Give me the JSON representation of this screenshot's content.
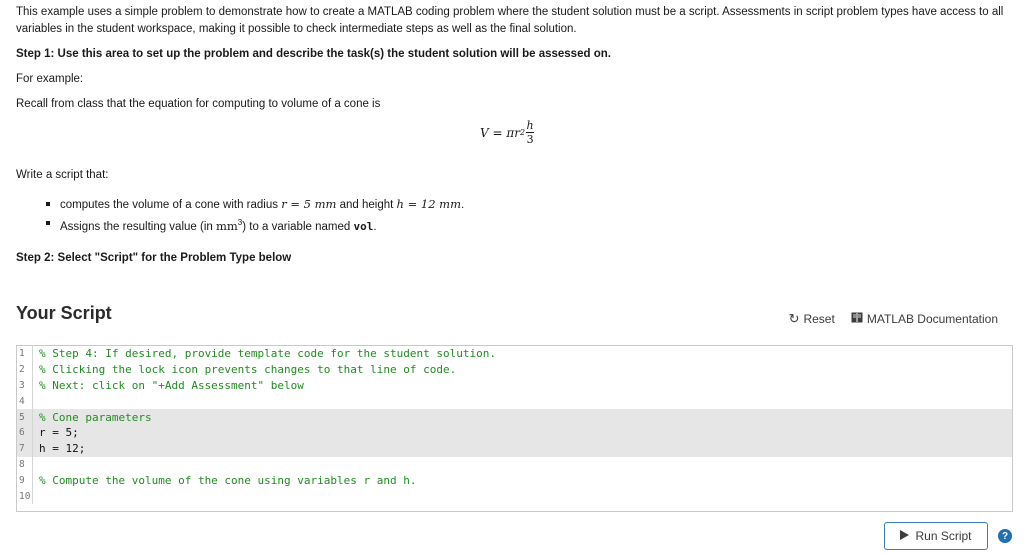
{
  "intro": "This example uses a simple problem to demonstrate how to create a MATLAB coding problem where the student solution must be a script. Assessments in script problem types have access to all variables in the student workspace, making it possible to check intermediate steps as well as the final solution.",
  "step1": "Step 1: Use this area to set up the problem and describe the task(s) the student solution will be assessed on.",
  "for_example": "For example:",
  "recall": "Recall from class that the equation for computing to volume of a cone is",
  "formula": {
    "lhs": "V = πr",
    "exp": "2",
    "num": "h",
    "den": "3"
  },
  "write": "Write a script that:",
  "tasks": {
    "t1_pre": "computes the volume of a cone with radius ",
    "t1_r": "r = 5 mm",
    "t1_mid": " and height ",
    "t1_h": "h = 12 mm",
    "t1_end": ".",
    "t2_pre": "Assigns the resulting value (in ",
    "t2_unit": "mm",
    "t2_exp": "3",
    "t2_mid": ") to a variable named ",
    "t2_var": "vol",
    "t2_end": "."
  },
  "step2": "Step 2: Select \"Script\" for the Problem Type below",
  "script_title": "Your Script",
  "toolbar": {
    "reset": "Reset",
    "docs": "MATLAB Documentation"
  },
  "code_lines": [
    {
      "n": "1",
      "text": "% Step 4: If desired, provide template code for the student solution."
    },
    {
      "n": "2",
      "text": "% Clicking the lock icon prevents changes to that line of code."
    },
    {
      "n": "3",
      "text": "% Next: click on \"+Add Assessment\" below"
    },
    {
      "n": "4",
      "text": ""
    },
    {
      "n": "5",
      "text": "% Cone parameters"
    },
    {
      "n": "6",
      "text": "r = 5;"
    },
    {
      "n": "7",
      "text": "h = 12;"
    },
    {
      "n": "8",
      "text": ""
    },
    {
      "n": "9",
      "text": "% Compute the volume of the cone using variables r and h."
    },
    {
      "n": "10",
      "text": ""
    }
  ],
  "run_label": "Run Script",
  "help": "?"
}
